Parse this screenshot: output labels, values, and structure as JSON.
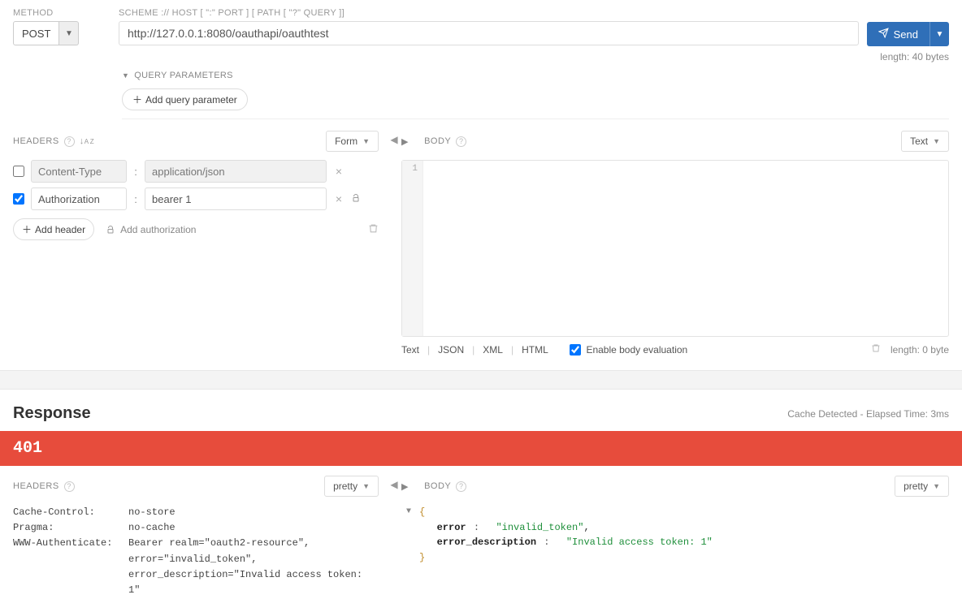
{
  "request": {
    "method_label": "METHOD",
    "method_value": "POST",
    "url_label": "SCHEME :// HOST [ \":\" PORT ] [ PATH [ \"?\" QUERY ]]",
    "url_value": "http://127.0.0.1:8080/oauthapi/oauthtest",
    "send_label": "Send",
    "length_hint": "length: 40 bytes",
    "query_params_title": "QUERY PARAMETERS",
    "add_query_param_label": "Add query parameter"
  },
  "headers_panel": {
    "title": "HEADERS",
    "mode_label": "Form",
    "rows": [
      {
        "checked": false,
        "name": "Content-Type",
        "value": "application/json",
        "readonly": true,
        "lock": false
      },
      {
        "checked": true,
        "name": "Authorization",
        "value": "bearer 1",
        "readonly": false,
        "lock": true
      }
    ],
    "add_header_label": "Add header",
    "add_auth_label": "Add authorization"
  },
  "body_panel": {
    "title": "BODY",
    "mode_label": "Text",
    "gutter_first": "1",
    "tabs": [
      "Text",
      "JSON",
      "XML",
      "HTML"
    ],
    "enable_eval_label": "Enable body evaluation",
    "enable_eval_checked": true,
    "length_hint": "length: 0 byte"
  },
  "response": {
    "title": "Response",
    "meta": "Cache Detected  -  Elapsed Time: 3ms",
    "status_code": "401",
    "headers_title": "HEADERS",
    "headers_mode": "pretty",
    "body_title": "BODY",
    "body_mode": "pretty",
    "headers": [
      {
        "key": "Cache-Control:",
        "value": "no-store"
      },
      {
        "key": "Pragma:",
        "value": "no-cache"
      },
      {
        "key": "WWW-Authenticate:",
        "value": "Bearer realm=\"oauth2-resource\", error=\"invalid_token\", error_description=\"Invalid access token: 1\""
      }
    ],
    "json": {
      "k1": "error",
      "v1": "\"invalid_token\"",
      "k2": "error_description",
      "v2": "\"Invalid access token: 1\""
    }
  }
}
